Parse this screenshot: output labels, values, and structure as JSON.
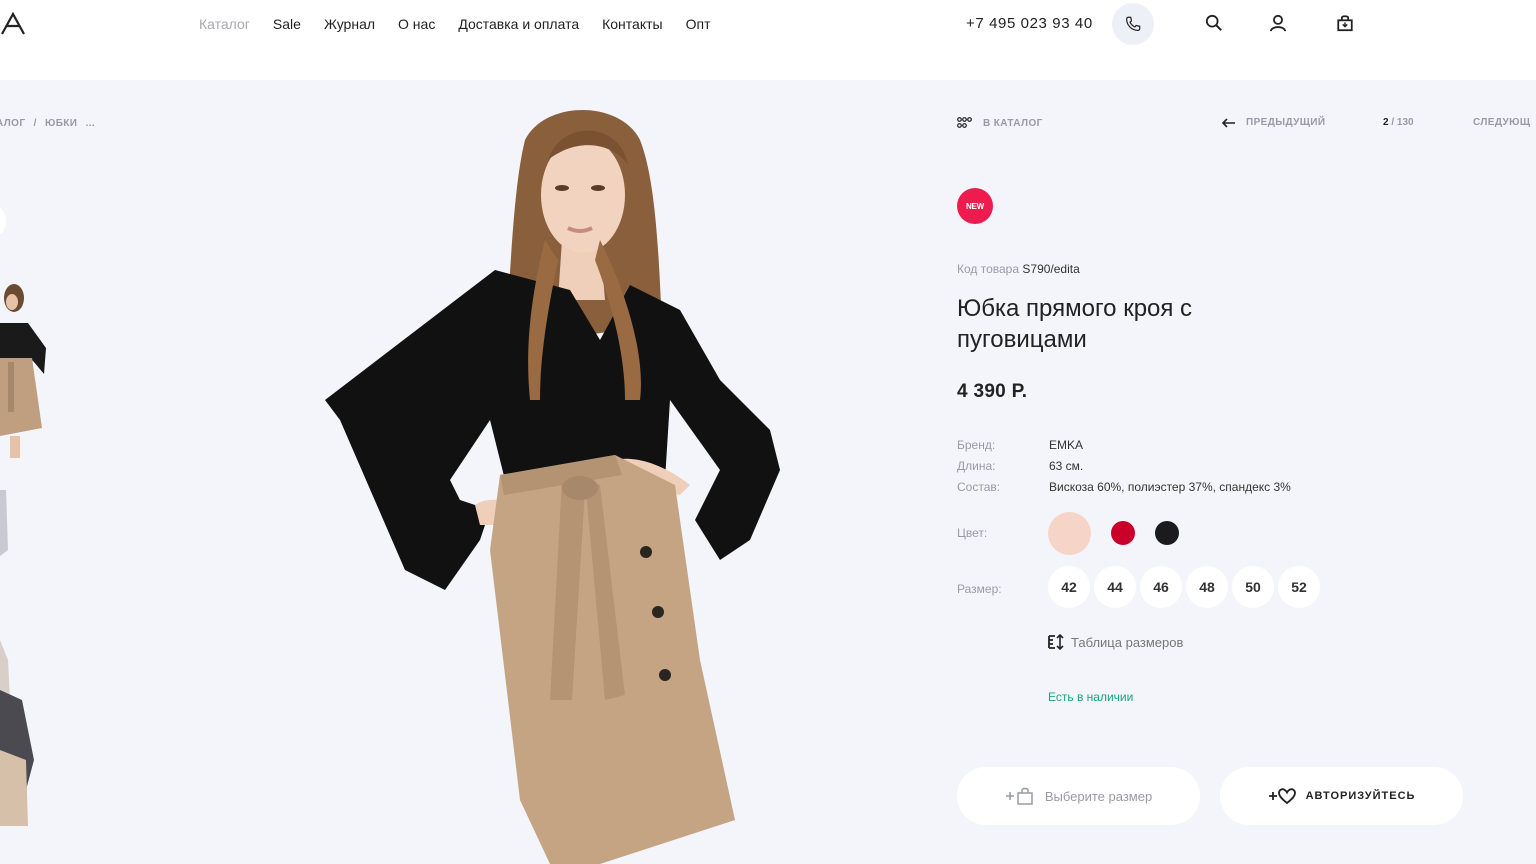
{
  "header": {
    "nav": [
      "Каталог",
      "Sale",
      "Журнал",
      "О нас",
      "Доставка и оплата",
      "Контакты",
      "Опт"
    ],
    "phone": "+7 495 023 93 40"
  },
  "breadcrumb": [
    "алог",
    "/",
    "юбки",
    "..."
  ],
  "topnav": {
    "catalog": "В каталог",
    "prev": "Предыдущий",
    "page_current": "2",
    "page_sep": " / ",
    "page_total": "130",
    "next": "Следующ"
  },
  "product": {
    "badge": "NEW",
    "sku_label": "Код товара",
    "sku": "S790/edita",
    "title": "Юбка прямого кроя с пуговицами",
    "price": "4 390 Р.",
    "props": [
      {
        "k": "Бренд:",
        "v": "EMKA"
      },
      {
        "k": "Длина:",
        "v": "63 см."
      },
      {
        "k": "Состав:",
        "v": "Вискоза 60%, полиэстер 37%, спандекс 3%"
      }
    ],
    "color_label": "Цвет:",
    "colors": [
      "#f7d4c8",
      "#c8002a",
      "#1b1b1d"
    ],
    "size_label": "Размер:",
    "sizes": [
      "42",
      "44",
      "46",
      "48",
      "50",
      "52"
    ],
    "size_table": "Таблица размеров",
    "stock": "Есть в наличии"
  },
  "buttons": {
    "choose_size": "Выберите размер",
    "auth": "Авторизуйтесь"
  }
}
